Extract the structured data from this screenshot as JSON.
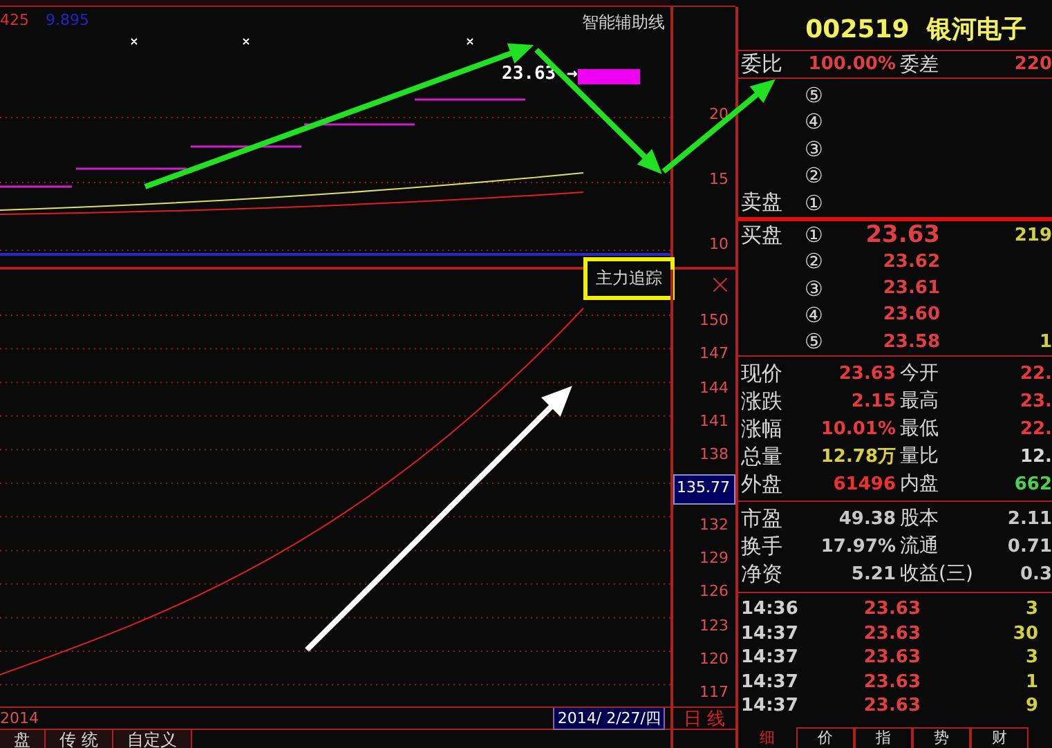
{
  "chart": {
    "indicator_values": [
      {
        "text": "425",
        "color": "#e03030"
      },
      {
        "text": "9.895",
        "color": "#2424c8"
      }
    ],
    "overlay_label": "智能辅助线",
    "price_tag": "23.63",
    "price_tag_arrow": "→",
    "upper_axis": [
      "20",
      "15",
      "10"
    ],
    "indicator_name": "主力追踪",
    "lower_axis": [
      {
        "text": "150",
        "kind": "tick"
      },
      {
        "text": "147",
        "kind": "tick"
      },
      {
        "text": "144",
        "kind": "tick"
      },
      {
        "text": "141",
        "kind": "tick"
      },
      {
        "text": "138",
        "kind": "tick"
      },
      {
        "text": "135.77",
        "kind": "current"
      },
      {
        "text": "132",
        "kind": "tick"
      },
      {
        "text": "129",
        "kind": "tick"
      },
      {
        "text": "126",
        "kind": "tick"
      },
      {
        "text": "123",
        "kind": "tick"
      },
      {
        "text": "120",
        "kind": "tick"
      },
      {
        "text": "117",
        "kind": "tick"
      }
    ],
    "date_start": "2014",
    "cursor_date": "2014/ 2/27/四",
    "period": "日 线",
    "tabs": [
      "盘",
      "传 统",
      "自定义"
    ]
  },
  "quote": {
    "code": "002519",
    "name": "银河电子",
    "ratio": {
      "label": "委比",
      "value": "100.00%",
      "label2": "委差",
      "value2": "220"
    },
    "sell_label": "卖盘",
    "sell": [
      {
        "rank": "⑤"
      },
      {
        "rank": "④"
      },
      {
        "rank": "③"
      },
      {
        "rank": "②"
      },
      {
        "rank": "①"
      }
    ],
    "buy_label": "买盘",
    "buy": [
      {
        "rank": "①",
        "price": "23.63",
        "volume": "219"
      },
      {
        "rank": "②",
        "price": "23.62"
      },
      {
        "rank": "③",
        "price": "23.61"
      },
      {
        "rank": "④",
        "price": "23.60"
      },
      {
        "rank": "⑤",
        "price": "23.58",
        "volume": "1"
      }
    ],
    "fields": [
      {
        "label": "现价",
        "value": "23.63",
        "color": "#e83c3c"
      },
      {
        "label": "今开",
        "value": "22.",
        "color": "#e83c3c"
      },
      {
        "label": "涨跌",
        "value": "2.15",
        "color": "#e83c3c"
      },
      {
        "label": "最高",
        "value": "23.",
        "color": "#e83c3c"
      },
      {
        "label": "涨幅",
        "value": "10.01%",
        "color": "#e83c3c"
      },
      {
        "label": "最低",
        "value": "22.",
        "color": "#e83c3c"
      },
      {
        "label": "总量",
        "value": "12.78万",
        "color": "#d8d040"
      },
      {
        "label": "量比",
        "value": "12.",
        "color": "#d8d8d8"
      },
      {
        "label": "外盘",
        "value": "61496",
        "color": "#f03030"
      },
      {
        "label": "内盘",
        "value": "662",
        "color": "#50d050"
      }
    ],
    "stats": [
      {
        "label": "市盈",
        "value": "49.38",
        "label2": "股本",
        "value2": "2.11"
      },
      {
        "label": "换手",
        "value": "17.97%",
        "label2": "流通",
        "value2": "0.71"
      },
      {
        "label": "净资",
        "value": "5.21",
        "label2": "收益(三)",
        "value2": "0.3"
      }
    ],
    "ticks": [
      {
        "time": "14:36",
        "price": "23.63",
        "volume": "3"
      },
      {
        "time": "14:37",
        "price": "23.63",
        "volume": "30"
      },
      {
        "time": "14:37",
        "price": "23.63",
        "volume": "3"
      },
      {
        "time": "14:37",
        "price": "23.63",
        "volume": "1"
      },
      {
        "time": "14:37",
        "price": "23.63",
        "volume": "9"
      }
    ],
    "tabs": [
      {
        "label": "细",
        "selected": true
      },
      {
        "label": "价",
        "selected": false
      },
      {
        "label": "指",
        "selected": false
      },
      {
        "label": "势",
        "selected": false
      },
      {
        "label": "财",
        "selected": false
      }
    ]
  }
}
